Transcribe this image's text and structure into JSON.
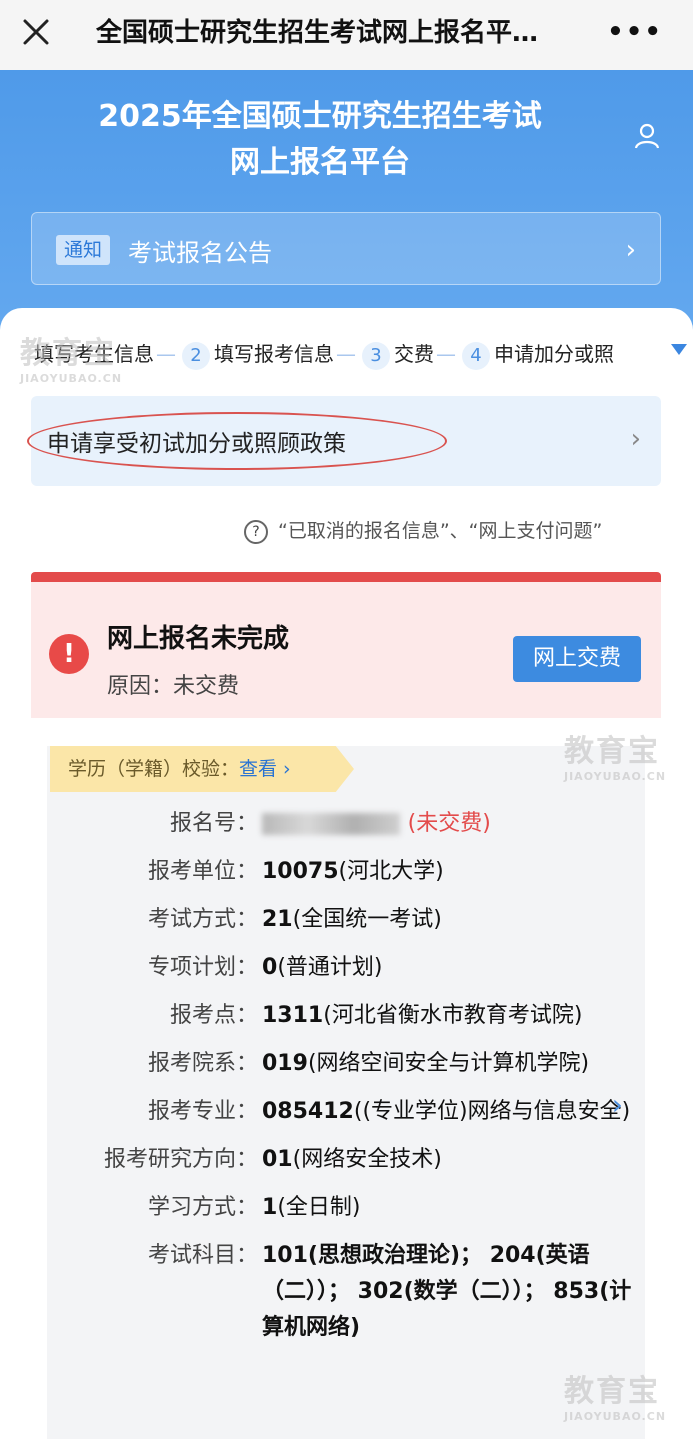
{
  "topbar": {
    "title": "全国硕士研究生招生考试网上报名平…",
    "more": "•••"
  },
  "header": {
    "title_line1": "2025年全国硕士研究生招生考试",
    "title_line2": "网上报名平台",
    "notice_tag": "通知",
    "notice_text": "考试报名公告"
  },
  "steps": {
    "s1": "填写考生信息",
    "n2": "2",
    "s2": "填写报考信息",
    "n3": "3",
    "s3": "交费",
    "n4": "4",
    "s4": "申请加分或照"
  },
  "apply": {
    "label": "申请享受初试加分或照顾政策"
  },
  "help": {
    "text": "“已取消的报名信息”、“网上支付问题”"
  },
  "status": {
    "title": "网上报名未完成",
    "reason": "原因：未交费",
    "pay_button": "网上交费"
  },
  "edu_check": {
    "label": "学历（学籍）校验：",
    "link": "查看 ›"
  },
  "details": [
    {
      "key": "报名号：",
      "value_suffix": "(未交费)"
    },
    {
      "key": "报考单位：",
      "code": "10075",
      "name": "(河北大学)"
    },
    {
      "key": "考试方式：",
      "code": "21",
      "name": "(全国统一考试)"
    },
    {
      "key": "专项计划：",
      "code": "0",
      "name": "(普通计划)"
    },
    {
      "key": "报考点：",
      "code": "1311",
      "name": "(河北省衡水市教育考试院)"
    },
    {
      "key": "报考院系：",
      "code": "019",
      "name": "(网络空间安全与计算机学院)"
    },
    {
      "key": "报考专业：",
      "code": "085412",
      "name": "((专业学位)网络与信息安全)"
    },
    {
      "key": "报考研究方向：",
      "code": "01",
      "name": "(网络安全技术)"
    },
    {
      "key": "学习方式：",
      "code": "1",
      "name": "(全日制)"
    },
    {
      "key": "考试科目：",
      "subjects": "101(思想政治理论)； 204(英语（二））； 302(数学（二））； 853(计算机网络)"
    }
  ],
  "watermark": {
    "big": "教育宝",
    "small": "JIAOYUBAO.CN"
  },
  "icons": [
    "close-icon",
    "more-icon",
    "user-icon",
    "chevron-right-icon",
    "question-circle-icon",
    "alert-icon"
  ]
}
